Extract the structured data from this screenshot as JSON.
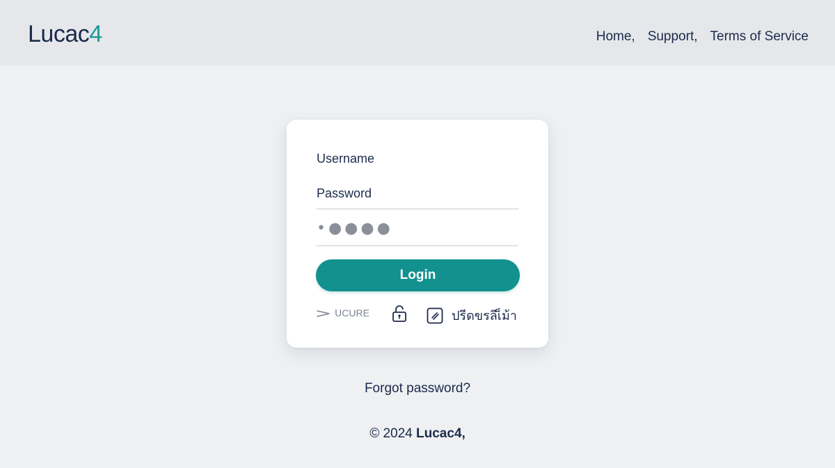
{
  "header": {
    "logo_main": "Lucac",
    "logo_accent": "4",
    "nav": [
      "Home,",
      "Support,",
      "Terms of Service"
    ]
  },
  "login": {
    "username_label": "Username",
    "password_label": "Password",
    "password_value": "•●●●●",
    "login_button": "Login",
    "secure_text": "ᑌCURE",
    "checkbox_label": "ปรีดขรลีเ็ม้า"
  },
  "footer": {
    "forgot": "Forgot password?",
    "copyright_prefix": "© 2024 ",
    "copyright_brand": "Lucac4,"
  },
  "colors": {
    "accent": "#12918f",
    "text": "#1b2a4b",
    "background": "#eef0f2"
  },
  "icons": [
    "arrow-icon",
    "lock-icon",
    "checkbox-icon"
  ]
}
